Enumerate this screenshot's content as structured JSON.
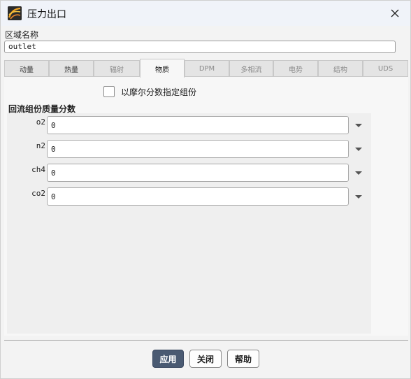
{
  "window": {
    "title": "压力出口",
    "icon": "fluent-logo-icon",
    "close_icon": "close-icon"
  },
  "zone": {
    "label": "区域名称",
    "value": "outlet"
  },
  "tabs": [
    {
      "label": "动量",
      "enabled": true
    },
    {
      "label": "热量",
      "enabled": true
    },
    {
      "label": "辐射",
      "enabled": false
    },
    {
      "label": "物质",
      "enabled": true,
      "active": true
    },
    {
      "label": "DPM",
      "enabled": false
    },
    {
      "label": "多相流",
      "enabled": false
    },
    {
      "label": "电势",
      "enabled": false
    },
    {
      "label": "结构",
      "enabled": false
    },
    {
      "label": "UDS",
      "enabled": false
    }
  ],
  "species": {
    "mole_fraction_checkbox": {
      "label": "以摩尔分数指定组份",
      "checked": false
    },
    "section_title": "回流组份质量分数",
    "rows": [
      {
        "name": "o2",
        "value": "0"
      },
      {
        "name": "n2",
        "value": "0"
      },
      {
        "name": "ch4",
        "value": "0"
      },
      {
        "name": "co2",
        "value": "0"
      }
    ]
  },
  "buttons": {
    "apply": "应用",
    "close": "关闭",
    "help": "帮助"
  },
  "colors": {
    "primary_button": "#4a5a72",
    "titlebar": "#f0f3f9",
    "background": "#f3f3f3"
  }
}
